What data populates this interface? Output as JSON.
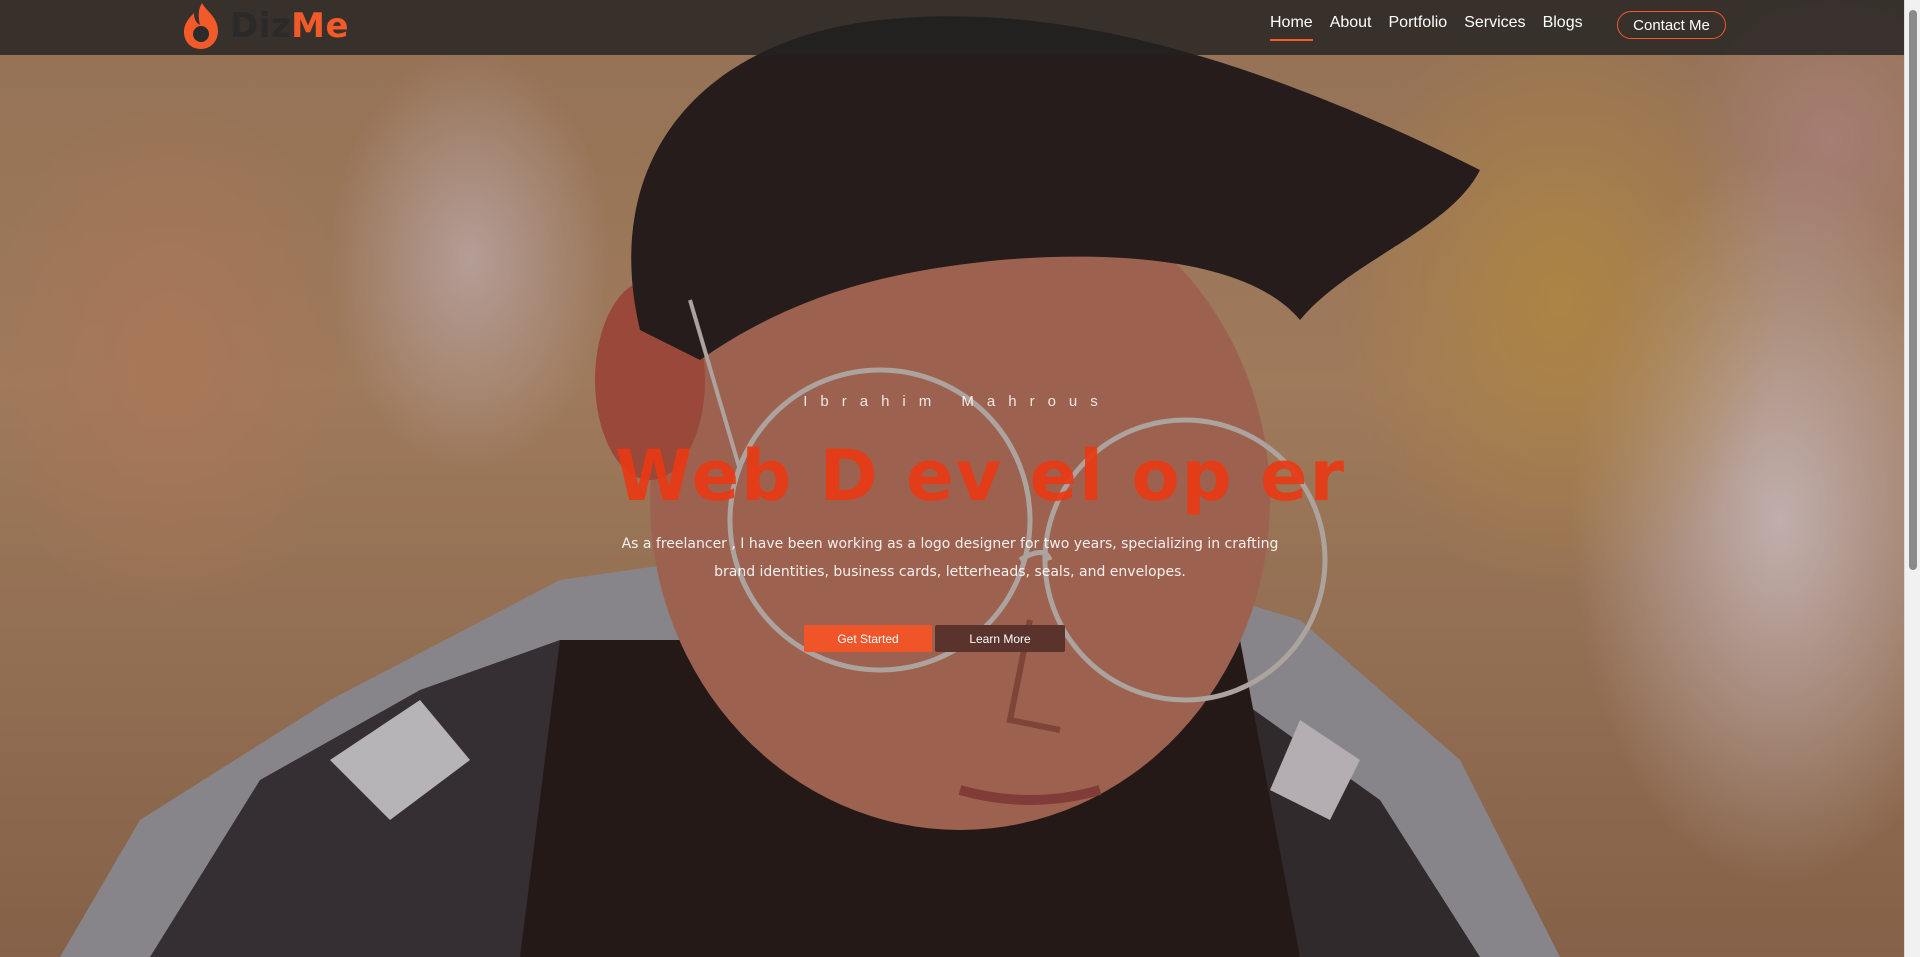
{
  "brand": {
    "name_part1": "Diz",
    "name_part2": "Me",
    "accent_color": "#f25a2a"
  },
  "nav": {
    "links": [
      {
        "label": "Home",
        "active": true
      },
      {
        "label": "About",
        "active": false
      },
      {
        "label": "Portfolio",
        "active": false
      },
      {
        "label": "Services",
        "active": false
      },
      {
        "label": "Blogs",
        "active": false
      }
    ],
    "contact_label": "Contact Me"
  },
  "hero": {
    "name": "Ibrahim Mahrous",
    "title": "Web D ev el op er",
    "description_line1": "As a freelancer , I have been working as a logo designer for two years, specializing in crafting",
    "description_line2": "brand identities, business cards, letterheads, seals, and envelopes.",
    "primary_button": "Get Started",
    "secondary_button": "Learn More",
    "title_color": "#e83a14",
    "primary_button_color": "#f0552a",
    "secondary_button_color": "#5a342c"
  }
}
